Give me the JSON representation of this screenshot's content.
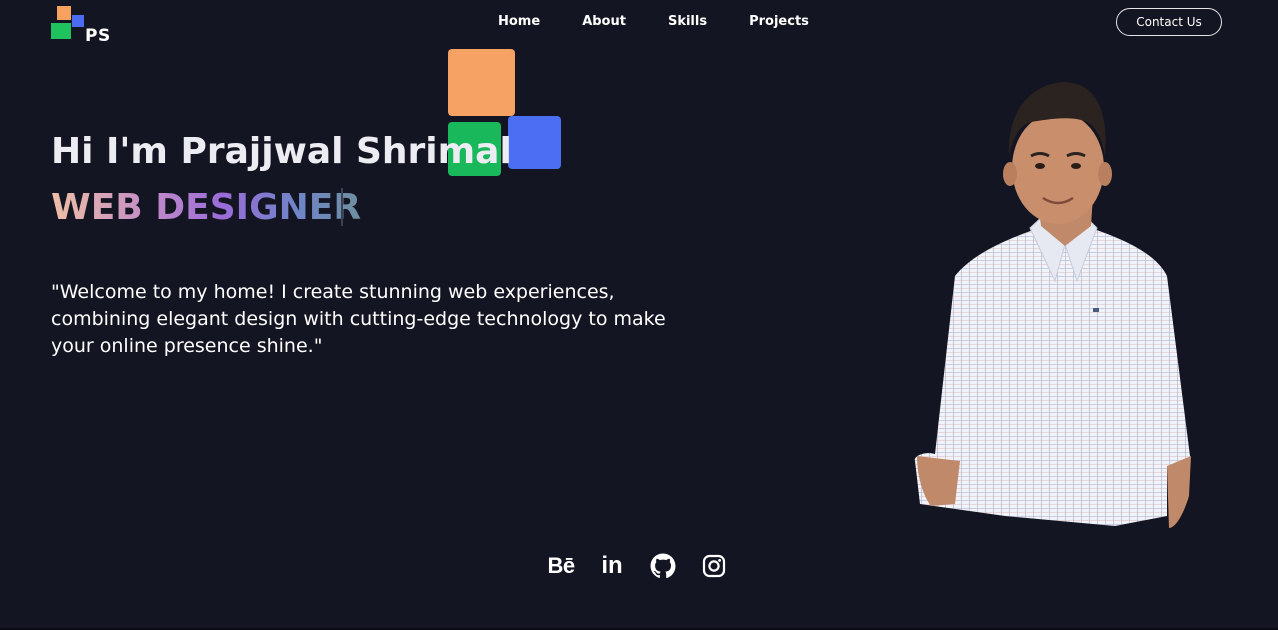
{
  "logo": {
    "text": "PS"
  },
  "nav": {
    "items": [
      {
        "label": "Home"
      },
      {
        "label": "About"
      },
      {
        "label": "Skills"
      },
      {
        "label": "Projects"
      }
    ],
    "contact_label": "Contact Us"
  },
  "hero": {
    "title": "Hi I'm Prajjwal Shrimal",
    "role": "WEB DESIGNER",
    "description": "\"Welcome to my home! I create stunning web experiences, combining elegant design with cutting-edge technology to make your online presence shine.\""
  },
  "social": {
    "behance_label": "Bē",
    "linkedin_label": "in",
    "icons": [
      "behance-icon",
      "linkedin-icon",
      "github-icon",
      "instagram-icon"
    ]
  },
  "colors": {
    "background": "#141522",
    "accent_orange": "#f6a264",
    "accent_green": "#19b85a",
    "accent_blue": "#4c6ef2"
  }
}
